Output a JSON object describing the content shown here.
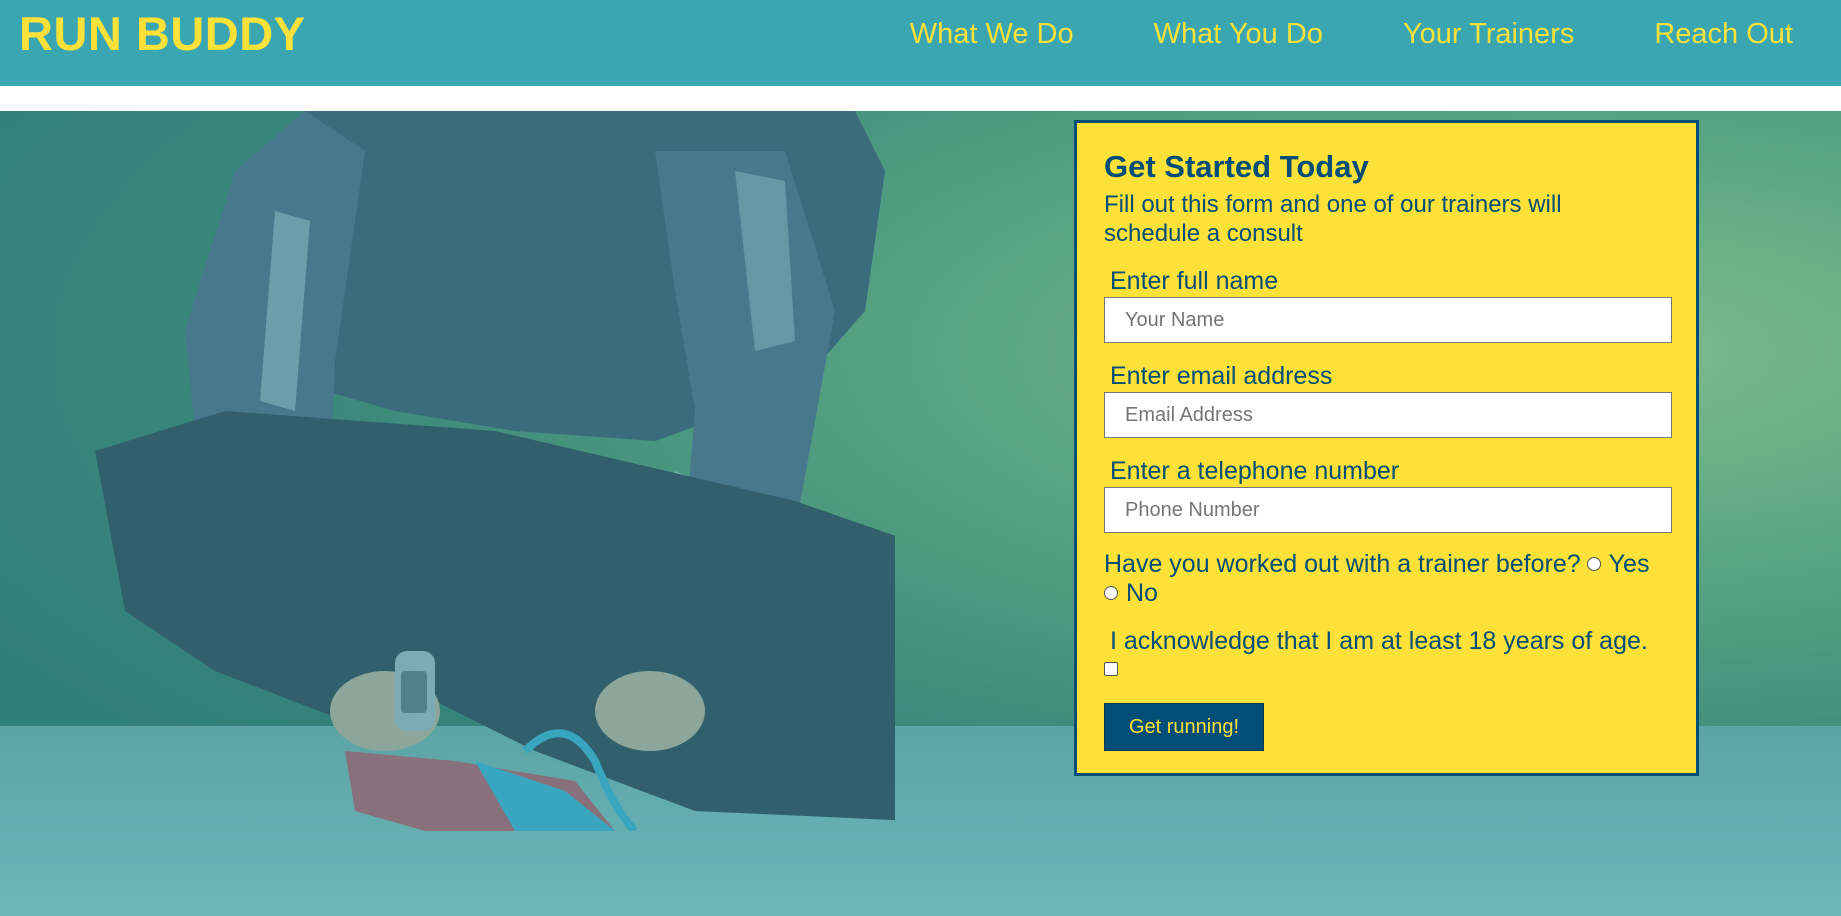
{
  "header": {
    "logo": "RUN BUDDY",
    "nav": [
      {
        "label": "What We Do"
      },
      {
        "label": "What You Do"
      },
      {
        "label": "Your Trainers"
      },
      {
        "label": "Reach Out"
      }
    ]
  },
  "form": {
    "title": "Get Started Today",
    "subtitle": "Fill out this form and one of our trainers will schedule a consult",
    "name_label": "Enter full name",
    "name_placeholder": "Your Name",
    "email_label": "Enter email address",
    "email_placeholder": "Email Address",
    "phone_label": "Enter a telephone number",
    "phone_placeholder": "Phone Number",
    "trainer_question": "Have you worked out with a trainer before?",
    "option_yes": "Yes",
    "option_no": "No",
    "ack_label": "I acknowledge that I am at least 18 years of age.",
    "submit_label": "Get running!"
  },
  "colors": {
    "header_bg": "#39a6b2",
    "accent_yellow": "#fce138",
    "dark_blue": "#024e76"
  }
}
